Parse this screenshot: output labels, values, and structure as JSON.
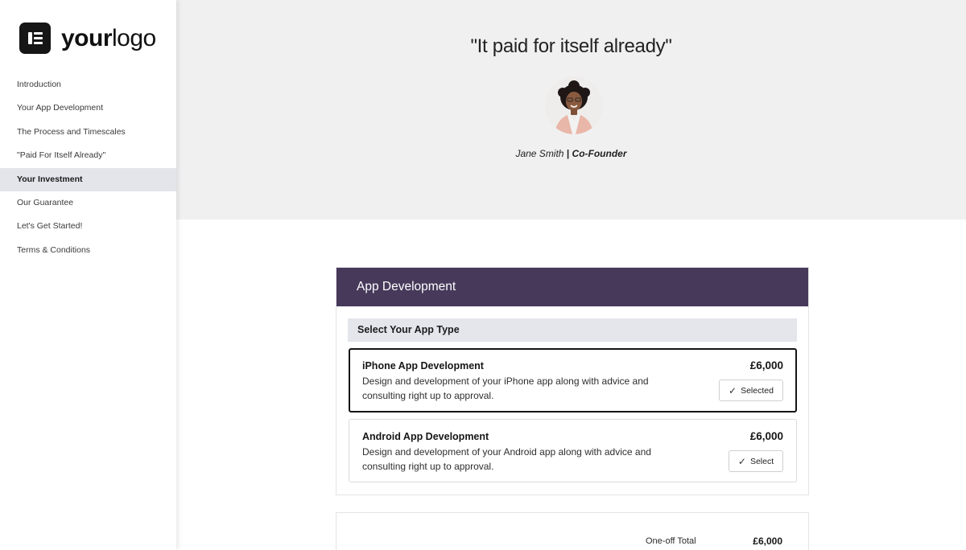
{
  "logo": {
    "text_bold": "your",
    "text_light": "logo"
  },
  "sidebar": {
    "items": [
      {
        "label": "Introduction",
        "active": false
      },
      {
        "label": "Your App Development",
        "active": false
      },
      {
        "label": "The Process and Timescales",
        "active": false
      },
      {
        "label": "\"Paid For Itself Already\"",
        "active": false
      },
      {
        "label": "Your Investment",
        "active": true
      },
      {
        "label": "Our Guarantee",
        "active": false
      },
      {
        "label": "Let's Get Started!",
        "active": false
      },
      {
        "label": "Terms & Conditions",
        "active": false
      }
    ]
  },
  "testimonial": {
    "quote": "\"It paid for itself already\"",
    "name": "Jane Smith",
    "separator": "|",
    "role": "Co-Founder"
  },
  "pricing": {
    "header": "App Development",
    "section_title": "Select Your App Type",
    "options": [
      {
        "title": "iPhone App Development",
        "description": "Design and development of your iPhone app along with advice and consulting right up to approval.",
        "price": "£6,000",
        "button_label": "Selected",
        "selected": true
      },
      {
        "title": "Android App Development",
        "description": "Design and development of your Android app along with advice and consulting right up to approval.",
        "price": "£6,000",
        "button_label": "Select",
        "selected": false
      }
    ]
  },
  "total": {
    "label": "One-off Total",
    "value": "£6,000"
  },
  "colors": {
    "header_purple": "#46395a",
    "hero_bg": "#f1f0f1",
    "active_nav_bg": "#e3e5ea",
    "section_bar_bg": "#e4e6ec"
  },
  "icons": {
    "check": "checkmark-icon",
    "logo": "logo-mark-icon"
  }
}
